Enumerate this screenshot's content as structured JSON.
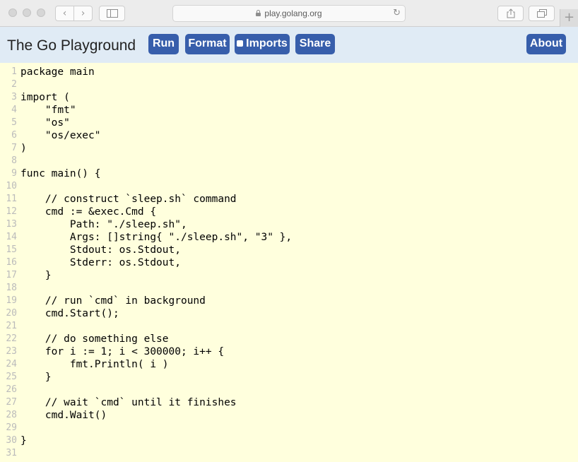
{
  "browser": {
    "url": "play.golang.org",
    "back_icon": "‹",
    "forward_icon": "›",
    "reload_icon": "↻",
    "new_tab_icon": "+"
  },
  "app": {
    "title": "The Go Playground",
    "buttons": {
      "run": "Run",
      "format": "Format",
      "imports": "Imports",
      "share": "Share",
      "about": "About"
    },
    "imports_checked": false,
    "accent_color": "#375eab",
    "header_bg": "#e0ebf5",
    "editor_bg": "#ffffdd"
  },
  "editor": {
    "line_numbers": [
      "1",
      "2",
      "3",
      "4",
      "5",
      "6",
      "7",
      "8",
      "9",
      "10",
      "11",
      "12",
      "13",
      "14",
      "15",
      "16",
      "17",
      "18",
      "19",
      "20",
      "21",
      "22",
      "23",
      "24",
      "25",
      "26",
      "27",
      "28",
      "29",
      "30",
      "31"
    ],
    "lines": [
      "package main",
      "",
      "import (",
      "    \"fmt\"",
      "    \"os\"",
      "    \"os/exec\"",
      ")",
      "",
      "func main() {",
      "",
      "    // construct `sleep.sh` command",
      "    cmd := &exec.Cmd {",
      "        Path: \"./sleep.sh\",",
      "        Args: []string{ \"./sleep.sh\", \"3\" },",
      "        Stdout: os.Stdout,",
      "        Stderr: os.Stdout,",
      "    }",
      "",
      "    // run `cmd` in background",
      "    cmd.Start();",
      "",
      "    // do something else",
      "    for i := 1; i < 300000; i++ {",
      "        fmt.Println( i )",
      "    }",
      "",
      "    // wait `cmd` until it finishes",
      "    cmd.Wait()",
      "",
      "}",
      ""
    ]
  }
}
